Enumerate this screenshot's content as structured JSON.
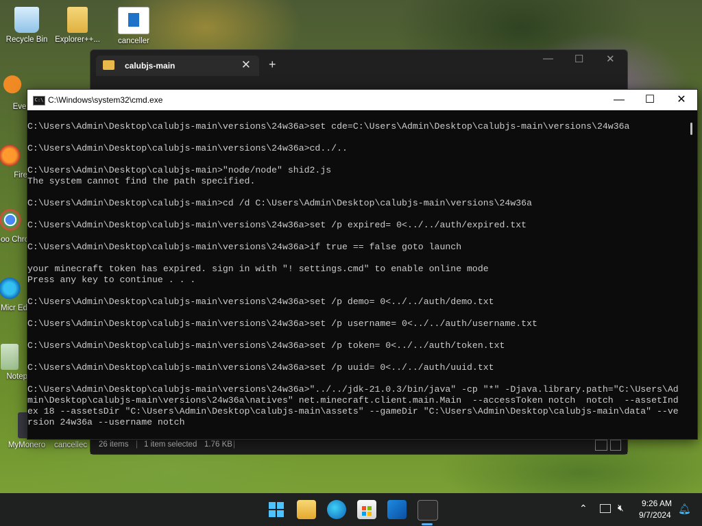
{
  "desktop": {
    "icons": [
      {
        "label": "Recycle Bin"
      },
      {
        "label": "Explorer++..."
      },
      {
        "label": "canceller"
      },
      {
        "label": "Every"
      },
      {
        "label": "Fire"
      },
      {
        "label": "Goo Chro"
      },
      {
        "label": "Micr Ed"
      },
      {
        "label": "Notep"
      },
      {
        "label": "MyMonero"
      },
      {
        "label": "cancellec"
      }
    ]
  },
  "explorer": {
    "tab_title": "calubjs-main",
    "close_glyph": "✕",
    "new_tab_glyph": "+",
    "status": {
      "items": "26 items",
      "selected": "1 item selected",
      "size": "1.76 KB"
    }
  },
  "cmd": {
    "title": "C:\\Windows\\system32\\cmd.exe",
    "lines": [
      "C:\\Users\\Admin\\Desktop\\calubjs-main\\versions\\24w36a>set cde=C:\\Users\\Admin\\Desktop\\calubjs-main\\versions\\24w36a",
      "",
      "C:\\Users\\Admin\\Desktop\\calubjs-main\\versions\\24w36a>cd../..",
      "",
      "C:\\Users\\Admin\\Desktop\\calubjs-main>\"node/node\" shid2.js",
      "The system cannot find the path specified.",
      "",
      "C:\\Users\\Admin\\Desktop\\calubjs-main>cd /d C:\\Users\\Admin\\Desktop\\calubjs-main\\versions\\24w36a",
      "",
      "C:\\Users\\Admin\\Desktop\\calubjs-main\\versions\\24w36a>set /p expired= 0<../../auth/expired.txt",
      "",
      "C:\\Users\\Admin\\Desktop\\calubjs-main\\versions\\24w36a>if true == false goto launch",
      "",
      "your minecraft token has expired. sign in with \"! settings.cmd\" to enable online mode",
      "Press any key to continue . . .",
      "",
      "C:\\Users\\Admin\\Desktop\\calubjs-main\\versions\\24w36a>set /p demo= 0<../../auth/demo.txt",
      "",
      "C:\\Users\\Admin\\Desktop\\calubjs-main\\versions\\24w36a>set /p username= 0<../../auth/username.txt",
      "",
      "C:\\Users\\Admin\\Desktop\\calubjs-main\\versions\\24w36a>set /p token= 0<../../auth/token.txt",
      "",
      "C:\\Users\\Admin\\Desktop\\calubjs-main\\versions\\24w36a>set /p uuid= 0<../../auth/uuid.txt",
      "",
      "C:\\Users\\Admin\\Desktop\\calubjs-main\\versions\\24w36a>\"../../jdk-21.0.3/bin/java\" -cp \"*\" -Djava.library.path=\"C:\\Users\\Ad",
      "min\\Desktop\\calubjs-main\\versions\\24w36a\\natives\" net.minecraft.client.main.Main  --accessToken notch  notch  --assetInd",
      "ex 18 --assetsDir \"C:\\Users\\Admin\\Desktop\\calubjs-main\\assets\" --gameDir \"C:\\Users\\Admin\\Desktop\\calubjs-main\\data\" --ve",
      "rsion 24w36a --username notch"
    ],
    "controls": {
      "minimize": "—",
      "maximize": "☐",
      "close": "✕"
    }
  },
  "taskbar": {
    "time": "9:26 AM",
    "date": "9/7/2024",
    "apps": [
      "start-icon",
      "file-explorer-icon",
      "edge-icon",
      "store-icon",
      "outlook-icon",
      "terminal-icon"
    ]
  },
  "colors": {
    "terminal_bg": "#0c0c0c",
    "terminal_fg": "#cccccc",
    "taskbar_bg": "#1f2020",
    "accent": "#5ab0f0"
  }
}
